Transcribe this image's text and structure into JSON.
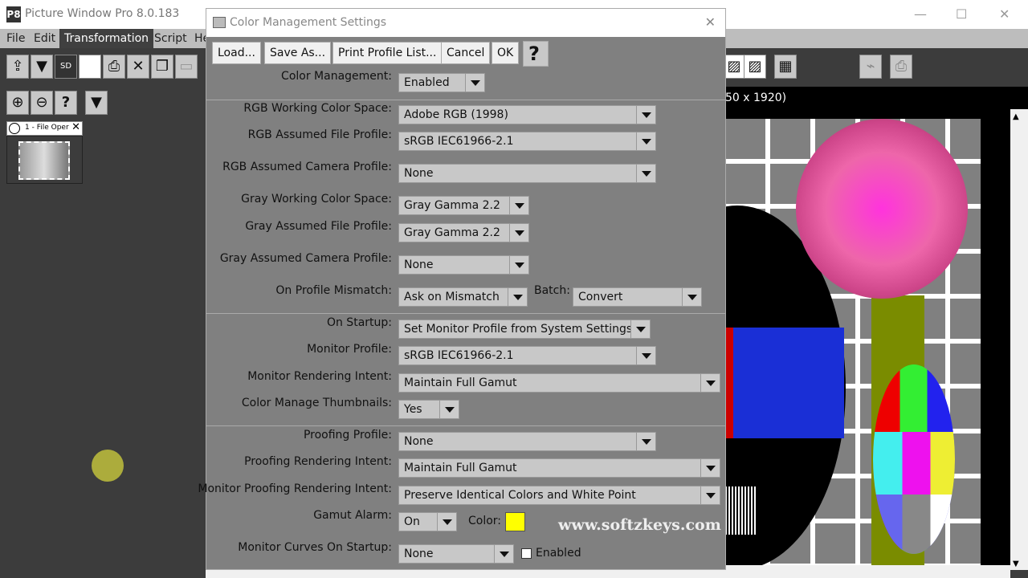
{
  "app": {
    "title": "Picture Window Pro 8.0.183",
    "icon": "P8"
  },
  "menu": [
    "File",
    "Edit",
    "Transformation",
    "Script",
    "He"
  ],
  "thumbnail_tab": {
    "label": "1 - File Oper"
  },
  "image_info": "50 x 1920)",
  "watermark": "www.softzkeys.com",
  "dialog": {
    "title": "Color Management Settings",
    "buttons": {
      "load": "Load...",
      "save_as": "Save As...",
      "print": "Print Profile List...",
      "cancel": "Cancel",
      "ok": "OK",
      "help": "?"
    },
    "color_management": {
      "label": "Color Management:",
      "value": "Enabled"
    },
    "rgb_working": {
      "label": "RGB Working Color Space:",
      "value": "Adobe RGB (1998)"
    },
    "rgb_file": {
      "label": "RGB Assumed File Profile:",
      "value": "sRGB IEC61966-2.1"
    },
    "rgb_camera": {
      "label": "RGB Assumed Camera Profile:",
      "value": "None"
    },
    "gray_working": {
      "label": "Gray Working Color Space:",
      "value": "Gray Gamma 2.2"
    },
    "gray_file": {
      "label": "Gray Assumed File Profile:",
      "value": "Gray Gamma 2.2"
    },
    "gray_camera": {
      "label": "Gray Assumed Camera Profile:",
      "value": "None"
    },
    "mismatch": {
      "label": "On Profile Mismatch:",
      "value": "Ask on Mismatch",
      "batch_label": "Batch:",
      "batch_value": "Convert"
    },
    "startup": {
      "label": "On Startup:",
      "value": "Set Monitor Profile from System Settings"
    },
    "monitor_profile": {
      "label": "Monitor Profile:",
      "value": "sRGB IEC61966-2.1"
    },
    "monitor_intent": {
      "label": "Monitor Rendering Intent:",
      "value": "Maintain Full Gamut"
    },
    "thumbnails": {
      "label": "Color Manage Thumbnails:",
      "value": "Yes"
    },
    "proofing_profile": {
      "label": "Proofing Profile:",
      "value": "None"
    },
    "proofing_intent": {
      "label": "Proofing Rendering Intent:",
      "value": "Maintain Full Gamut"
    },
    "monitor_proofing_intent": {
      "label": "Monitor Proofing Rendering Intent:",
      "value": "Preserve Identical Colors and White Point"
    },
    "gamut_alarm": {
      "label": "Gamut Alarm:",
      "value": "On",
      "color_label": "Color:",
      "color": "#ffff00"
    },
    "curves": {
      "label": "Monitor Curves On Startup:",
      "value": "None",
      "enabled_label": "Enabled",
      "enabled": false
    }
  }
}
